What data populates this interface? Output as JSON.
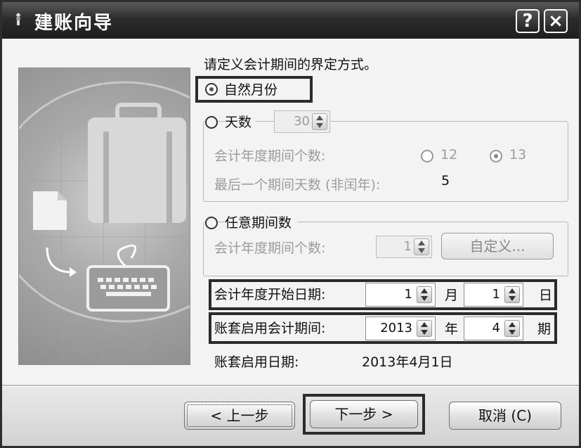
{
  "window": {
    "title": "建账向导",
    "help_label": "?",
    "close_label": "×"
  },
  "prompt": "请定义会计期间的界定方式。",
  "options": {
    "natural_month": {
      "label": "自然月份",
      "selected": true
    },
    "days": {
      "label": "天数",
      "value": "30",
      "period_count_label": "会计年度期间个数:",
      "choice_12": "12",
      "choice_13": "13",
      "selected_choice": "13",
      "last_period_label": "最后一个期间天数 (非闰年):",
      "last_period_value": "5"
    },
    "arbitrary": {
      "label": "任意期间数",
      "period_count_label": "会计年度期间个数:",
      "period_count_value": "1",
      "custom_button": "自定义..."
    }
  },
  "fiscal_start": {
    "label": "会计年度开始日期:",
    "month_value": "1",
    "month_unit": "月",
    "day_value": "1",
    "day_unit": "日"
  },
  "enable_period": {
    "label": "账套启用会计期间:",
    "year_value": "2013",
    "year_unit": "年",
    "period_value": "4",
    "period_unit": "期"
  },
  "enable_date": {
    "label": "账套启用日期:",
    "value": "2013年4月1日"
  },
  "buttons": {
    "back": "< 上一步",
    "next": "下一步 >",
    "cancel": "取消 (C)"
  }
}
